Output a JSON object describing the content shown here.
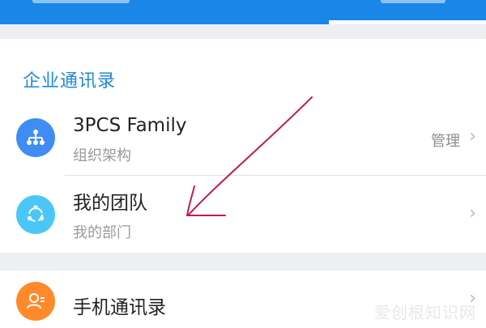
{
  "section": {
    "title": "企业通讯录"
  },
  "rows": [
    {
      "title": "3PCS Family",
      "subtitle": "组织架构",
      "action": "管理",
      "icon": "org-chart-icon",
      "icon_color": "#3f8df3"
    },
    {
      "title": "我的团队",
      "subtitle": "我的部门",
      "icon": "team-icon",
      "icon_color": "#4ac7f6"
    },
    {
      "title": "手机通讯录",
      "icon": "phone-contacts-icon",
      "icon_color": "#ff8a2a"
    }
  ],
  "chevron": "›",
  "watermark": "爱创根知识网",
  "colors": {
    "accent": "#1a86e8",
    "section_title": "#1e8ad6",
    "annotation": "#c2185b"
  }
}
